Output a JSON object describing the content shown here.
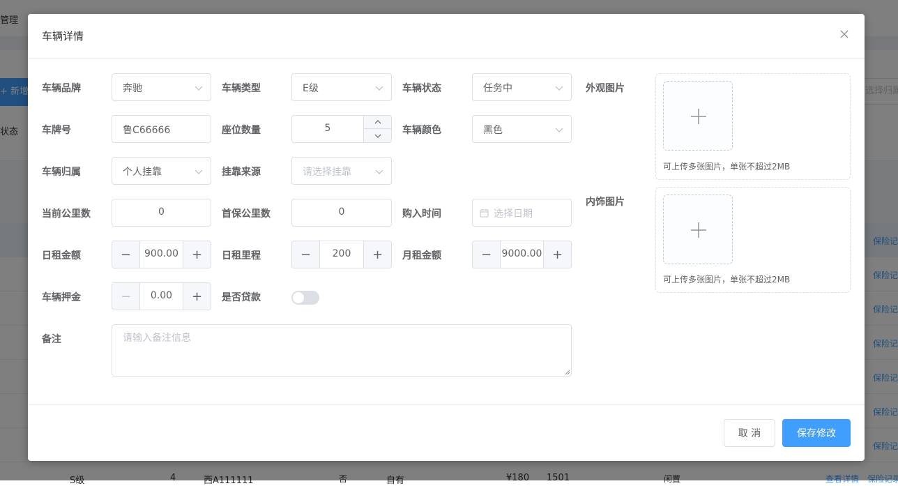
{
  "background": {
    "page_title": "管理",
    "add_button": "+ 新增",
    "status_label": "状态",
    "select_placeholder": "选择归属",
    "row_link": "保险记录",
    "last_row": {
      "level": "S级",
      "seats": "4",
      "plate": "西A111111",
      "loan": "否",
      "ownership": "自有",
      "price": "¥180",
      "mileage": "1501",
      "state": "闲置",
      "detail_link": "查看详情",
      "insurance_link": "保险记录"
    }
  },
  "dialog": {
    "title": "车辆详情",
    "fields": {
      "brand": {
        "label": "车辆品牌",
        "value": "奔驰"
      },
      "type": {
        "label": "车辆类型",
        "value": "E级"
      },
      "status": {
        "label": "车辆状态",
        "value": "任务中"
      },
      "plate": {
        "label": "车牌号",
        "value": "鲁C66666"
      },
      "seats": {
        "label": "座位数量",
        "value": "5"
      },
      "color": {
        "label": "车辆颜色",
        "value": "黑色"
      },
      "ownership": {
        "label": "车辆归属",
        "value": "个人挂靠"
      },
      "source": {
        "label": "挂靠来源",
        "placeholder": "请选择挂靠"
      },
      "current_mileage": {
        "label": "当前公里数",
        "value": "0"
      },
      "warranty_mileage": {
        "label": "首保公里数",
        "value": "0"
      },
      "purchase_date": {
        "label": "购入时间",
        "placeholder": "选择日期"
      },
      "daily_rent": {
        "label": "日租金额",
        "value": "900.00"
      },
      "daily_mileage": {
        "label": "日租里程",
        "value": "200"
      },
      "monthly_rent": {
        "label": "月租金额",
        "value": "9000.00"
      },
      "deposit": {
        "label": "车辆押金",
        "value": "0.00"
      },
      "loan": {
        "label": "是否贷款",
        "on": false
      },
      "remark": {
        "label": "备注",
        "placeholder": "请输入备注信息"
      }
    },
    "exterior": {
      "label": "外观图片",
      "tip": "可上传多张图片，单张不超过2MB"
    },
    "interior": {
      "label": "内饰图片",
      "tip": "可上传多张图片，单张不超过2MB"
    },
    "buttons": {
      "cancel": "取 消",
      "save": "保存修改"
    }
  },
  "colors": {
    "primary": "#409eff",
    "overlay": "rgba(0,0,0,0.5)",
    "switch_off": "#dcdfe6",
    "label": "#606266",
    "placeholder": "#c0c4cc"
  }
}
